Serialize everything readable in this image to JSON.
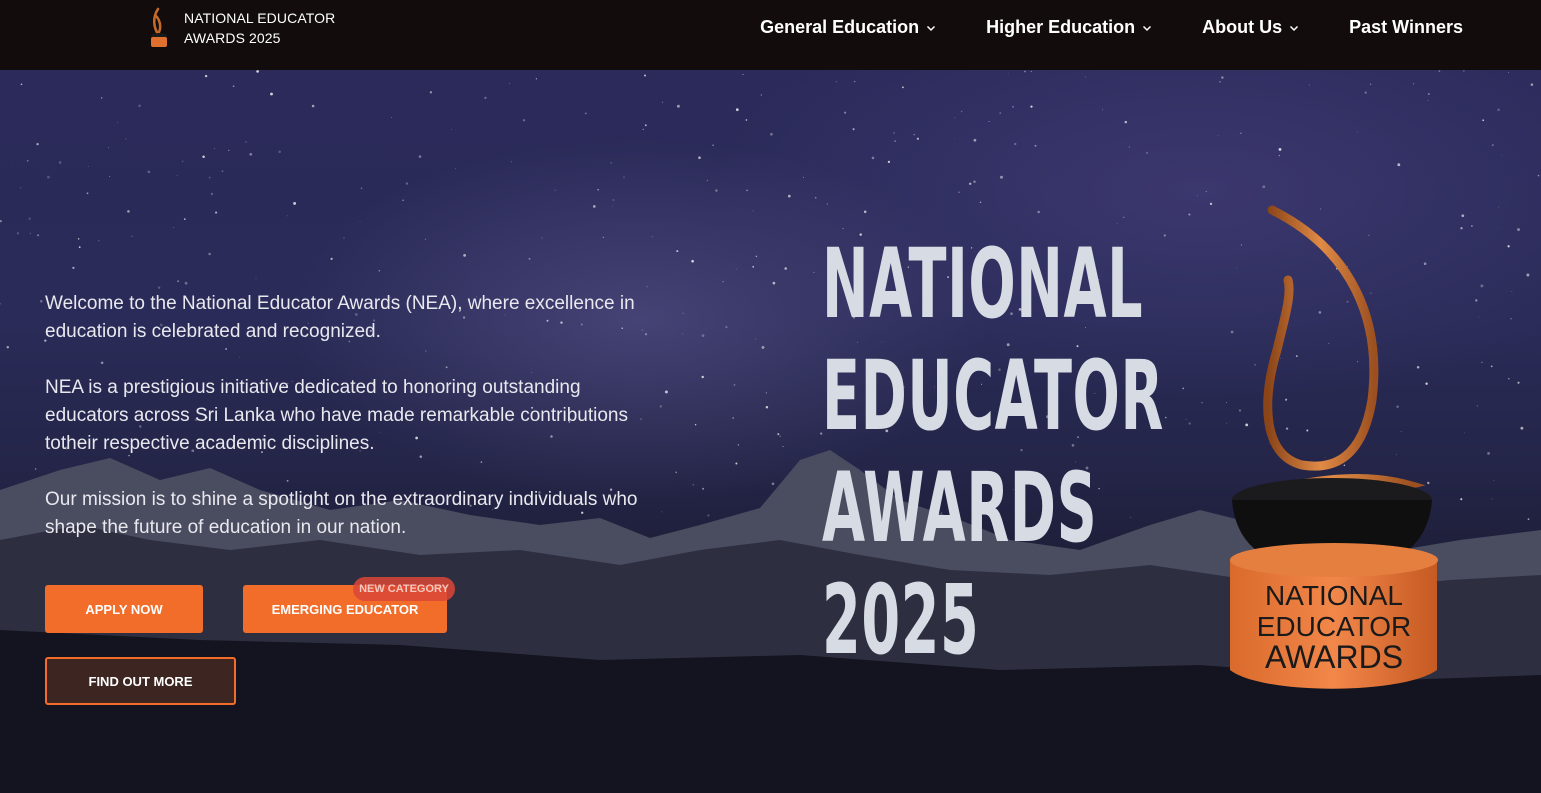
{
  "header": {
    "logo_icon": "trophy-flame-icon",
    "brand_line1": "NATIONAL EDUCATOR",
    "brand_line2": "AWARDS 2025",
    "nav": [
      {
        "label": "General Education",
        "dropdown": true
      },
      {
        "label": "Higher Education",
        "dropdown": true
      },
      {
        "label": "About Us",
        "dropdown": true
      },
      {
        "label": "Past Winners",
        "dropdown": false
      }
    ]
  },
  "hero": {
    "paragraphs": [
      "Welcome to the National Educator Awards (NEA), where excellence in education is celebrated and recognized.",
      "NEA is a prestigious initiative dedicated to honoring outstanding educators across Sri Lanka who have made remarkable contributions totheir respective academic disciplines.",
      "Our mission is to shine a spotlight on the extraordinary individuals who shape the future of education in our nation."
    ],
    "apply_label": "APPLY NOW",
    "emerging_label": "EMERGING EDUCATOR",
    "badge_label": "NEW CATEGORY",
    "find_more_label": "FIND OUT MORE",
    "title_lines": [
      "NATIONAL",
      "EDUCATOR",
      "AWARDS",
      "2025"
    ],
    "trophy_text": [
      "NATIONAL",
      "EDUCATOR",
      "AWARDS"
    ]
  },
  "colors": {
    "accent": "#f26d2a",
    "header_bg": "#130c0c",
    "title": "#d7dbe3",
    "sky": "#2b2a5a"
  }
}
